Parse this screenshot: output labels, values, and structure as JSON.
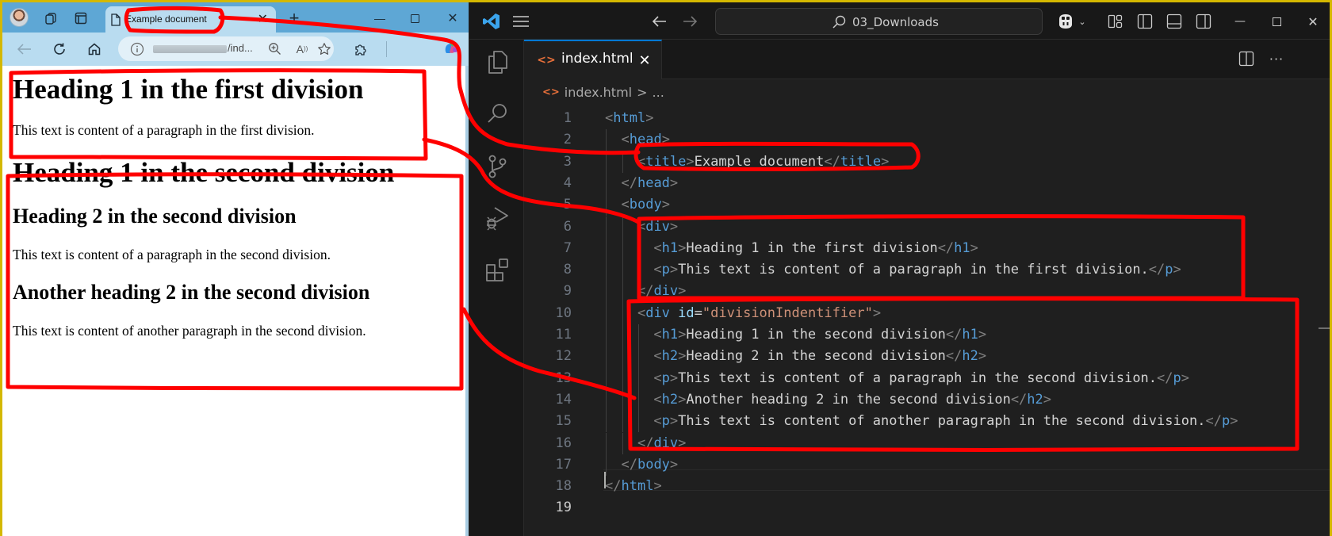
{
  "browser": {
    "tab": {
      "title": "Example document",
      "close_icon": "close-icon"
    },
    "toolbar_icons": [
      "avatar",
      "workspaces-icon",
      "tab-actions-icon",
      "page-icon",
      "new-tab-icon"
    ],
    "window_controls": {
      "minimize": "—",
      "maximize": "☐",
      "close": "✕"
    },
    "address_bar": {
      "url_visible": "/ind...",
      "info_icon": "info-icon"
    },
    "nav_icons": [
      "back-icon",
      "refresh-icon",
      "home-icon",
      "zoom-icon",
      "read-aloud-icon",
      "favorite-star-icon",
      "extensions-icon",
      "copilot-icon"
    ],
    "page": {
      "div1": {
        "h1": "Heading 1 in the first division",
        "p": "This text is content of a paragraph in the first division."
      },
      "div2": {
        "h1": "Heading 1 in the second division",
        "h2a": "Heading 2 in the second division",
        "p1": "This text is content of a paragraph in the second division.",
        "h2b": "Another heading 2 in the second division",
        "p2": "This text is content of another paragraph in the second division."
      }
    }
  },
  "vscode": {
    "title_search": "03_Downloads",
    "active_tab": "index.html",
    "breadcrumb": {
      "file": "index.html",
      "separator": ">",
      "more": "..."
    },
    "current_line": 19,
    "lines": [
      {
        "n": "1",
        "indent": 0,
        "tokens": [
          [
            "p",
            "<"
          ],
          [
            "t",
            "html"
          ],
          [
            "p",
            ">"
          ]
        ]
      },
      {
        "n": "2",
        "indent": 1,
        "tokens": [
          [
            "p",
            "<"
          ],
          [
            "t",
            "head"
          ],
          [
            "p",
            ">"
          ]
        ]
      },
      {
        "n": "3",
        "indent": 2,
        "tokens": [
          [
            "p",
            "<"
          ],
          [
            "t",
            "title"
          ],
          [
            "p",
            ">"
          ],
          [
            "x",
            "Example document"
          ],
          [
            "p",
            "</"
          ],
          [
            "t",
            "title"
          ],
          [
            "p",
            ">"
          ]
        ]
      },
      {
        "n": "4",
        "indent": 1,
        "tokens": [
          [
            "p",
            "</"
          ],
          [
            "t",
            "head"
          ],
          [
            "p",
            ">"
          ]
        ]
      },
      {
        "n": "5",
        "indent": 1,
        "tokens": [
          [
            "p",
            "<"
          ],
          [
            "t",
            "body"
          ],
          [
            "p",
            ">"
          ]
        ]
      },
      {
        "n": "6",
        "indent": 2,
        "tokens": [
          [
            "p",
            "<"
          ],
          [
            "t",
            "div"
          ],
          [
            "p",
            ">"
          ]
        ]
      },
      {
        "n": "7",
        "indent": 3,
        "tokens": [
          [
            "p",
            "<"
          ],
          [
            "t",
            "h1"
          ],
          [
            "p",
            ">"
          ],
          [
            "x",
            "Heading 1 in the first division"
          ],
          [
            "p",
            "</"
          ],
          [
            "t",
            "h1"
          ],
          [
            "p",
            ">"
          ]
        ]
      },
      {
        "n": "8",
        "indent": 3,
        "tokens": [
          [
            "p",
            "<"
          ],
          [
            "t",
            "p"
          ],
          [
            "p",
            ">"
          ],
          [
            "x",
            "This text is content of a paragraph in the first division."
          ],
          [
            "p",
            "</"
          ],
          [
            "t",
            "p"
          ],
          [
            "p",
            ">"
          ]
        ]
      },
      {
        "n": "9",
        "indent": 2,
        "tokens": [
          [
            "p",
            "</"
          ],
          [
            "t",
            "div"
          ],
          [
            "p",
            ">"
          ]
        ]
      },
      {
        "n": "10",
        "indent": 2,
        "tokens": [
          [
            "p",
            "<"
          ],
          [
            "t",
            "div"
          ],
          [
            "x",
            " "
          ],
          [
            "a",
            "id"
          ],
          [
            "x",
            "="
          ],
          [
            "s",
            "\"divisionIndentifier\""
          ],
          [
            "p",
            ">"
          ]
        ]
      },
      {
        "n": "11",
        "indent": 3,
        "tokens": [
          [
            "p",
            "<"
          ],
          [
            "t",
            "h1"
          ],
          [
            "p",
            ">"
          ],
          [
            "x",
            "Heading 1 in the second division"
          ],
          [
            "p",
            "</"
          ],
          [
            "t",
            "h1"
          ],
          [
            "p",
            ">"
          ]
        ]
      },
      {
        "n": "12",
        "indent": 3,
        "tokens": [
          [
            "p",
            "<"
          ],
          [
            "t",
            "h2"
          ],
          [
            "p",
            ">"
          ],
          [
            "x",
            "Heading 2 in the second division"
          ],
          [
            "p",
            "</"
          ],
          [
            "t",
            "h2"
          ],
          [
            "p",
            ">"
          ]
        ]
      },
      {
        "n": "13",
        "indent": 3,
        "tokens": [
          [
            "p",
            "<"
          ],
          [
            "t",
            "p"
          ],
          [
            "p",
            ">"
          ],
          [
            "x",
            "This text is content of a paragraph in the second division."
          ],
          [
            "p",
            "</"
          ],
          [
            "t",
            "p"
          ],
          [
            "p",
            ">"
          ]
        ]
      },
      {
        "n": "14",
        "indent": 3,
        "tokens": [
          [
            "p",
            "<"
          ],
          [
            "t",
            "h2"
          ],
          [
            "p",
            ">"
          ],
          [
            "x",
            "Another heading 2 in the second division"
          ],
          [
            "p",
            "</"
          ],
          [
            "t",
            "h2"
          ],
          [
            "p",
            ">"
          ]
        ]
      },
      {
        "n": "15",
        "indent": 3,
        "tokens": [
          [
            "p",
            "<"
          ],
          [
            "t",
            "p"
          ],
          [
            "p",
            ">"
          ],
          [
            "x",
            "This text is content of another paragraph in the second division."
          ],
          [
            "p",
            "</"
          ],
          [
            "t",
            "p"
          ],
          [
            "p",
            ">"
          ]
        ]
      },
      {
        "n": "16",
        "indent": 2,
        "tokens": [
          [
            "p",
            "</"
          ],
          [
            "t",
            "div"
          ],
          [
            "p",
            ">"
          ]
        ]
      },
      {
        "n": "17",
        "indent": 1,
        "tokens": [
          [
            "p",
            "</"
          ],
          [
            "t",
            "body"
          ],
          [
            "p",
            ">"
          ]
        ]
      },
      {
        "n": "18",
        "indent": 0,
        "tokens": [
          [
            "p",
            "</"
          ],
          [
            "t",
            "html"
          ],
          [
            "p",
            ">"
          ]
        ]
      },
      {
        "n": "19",
        "indent": 0,
        "tokens": []
      }
    ]
  },
  "annotations": {
    "color": "#ff0000",
    "description": "Red hand-drawn outlines linking browser render to source code"
  },
  "colors": {
    "vscode_accent": "#0078d4",
    "tag": "#569cd6",
    "attribute": "#9cdcfe",
    "string": "#ce9178",
    "file_icon": "#e8703a",
    "browser_tabstrip": "#5ea7d5",
    "frame_border": "#d4b800"
  }
}
